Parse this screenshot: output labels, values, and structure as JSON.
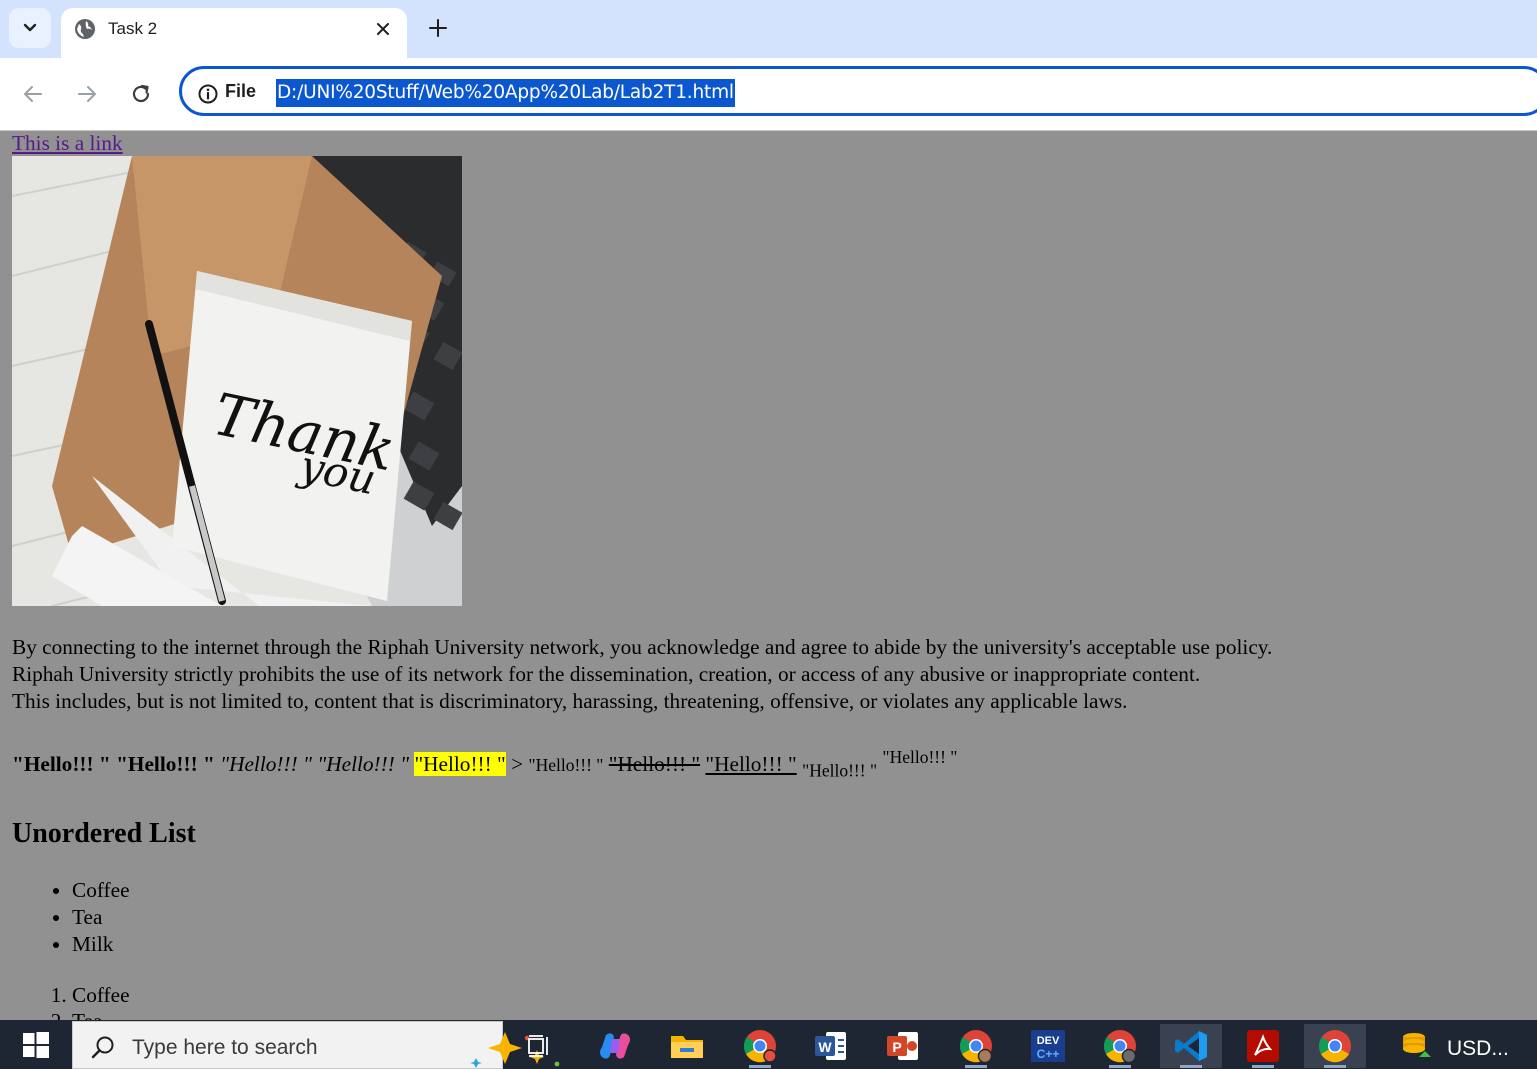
{
  "browser": {
    "tab_title": "Task 2",
    "address_scheme": "File",
    "address_url": "D:/UNI%20Stuff/Web%20App%20Lab/Lab2T1.html"
  },
  "page": {
    "link_text": "This is a link",
    "image_alt_text": "Thank you",
    "paragraph_lines": [
      "By connecting to the internet through the Riphah University network, you acknowledge and agree to abide by the university's acceptable use policy.",
      "Riphah University strictly prohibits the use of its network for the dissemination, creation, or access of any abusive or inappropriate content.",
      "This includes, but is not limited to, content that is discriminatory, harassing, threatening, offensive, or violates any applicable laws."
    ],
    "hello_items": {
      "bold": "\"Hello!!! \"",
      "strong": "\"Hello!!! \"",
      "italic": "\"Hello!!! \"",
      "emphasis": "\"Hello!!! \"",
      "marked": "\"Hello!!! \"",
      "gt": ">",
      "small": "\"Hello!!! \"",
      "deleted": "\"Hello!!! \"",
      "inserted": "\"Hello!!! \"",
      "subscript": "\"Hello!!! \"",
      "superscript": "\"Hello!!! \""
    },
    "list_heading": "Unordered List",
    "unordered_items": [
      "Coffee",
      "Tea",
      "Milk"
    ],
    "ordered_items": [
      "Coffee",
      "Tea"
    ]
  },
  "taskbar": {
    "search_placeholder": "Type here to search",
    "tray_label": "USD..."
  },
  "colors": {
    "page_background": "#919192",
    "link": "#551a8b",
    "highlight": "#ffff00",
    "omnibox_border": "#0b57d0",
    "tabstrip": "#d3e3fd",
    "taskbar": "#1f2633"
  },
  "icons": [
    "chevron-down-icon",
    "globe-icon",
    "close-icon",
    "plus-icon",
    "back-arrow-icon",
    "forward-arrow-icon",
    "reload-icon",
    "info-icon",
    "windows-start-icon",
    "search-icon",
    "copilot-sparkle-icon",
    "task-view-icon",
    "copilot-icon",
    "file-explorer-icon",
    "chrome-icon",
    "word-icon",
    "powerpoint-icon",
    "devcpp-icon",
    "vscode-icon",
    "acrobat-icon",
    "coins-icon"
  ]
}
